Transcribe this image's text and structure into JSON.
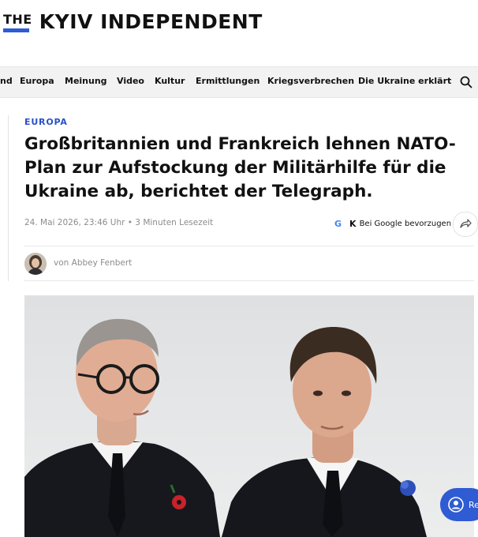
{
  "brand": {
    "the": "THE",
    "name": "KYIV INDEPENDENT",
    "accent": "#2f5bd3"
  },
  "nav": {
    "items": [
      "nd",
      "Europa",
      "Meinung",
      "Video",
      "Kultur",
      "Ermittlungen",
      "Kriegsverbrechen",
      "Die Ukraine erklärt"
    ],
    "search_icon": "search-icon"
  },
  "article": {
    "category": "EUROPA",
    "headline": "Großbritannien und Frankreich lehnen NATO-Plan zur Aufstockung der Militärhilfe für die Ukraine ab, berichtet der Telegraph.",
    "meta": "24. Mai 2026, 23:46 Uhr • 3 Minuten Lesezeit",
    "google_icon": "G",
    "kyiv_icon": "K",
    "google_label": "Bei Google bevorzugen",
    "share_icon": "share-arrow-icon",
    "byline": "von Abbey Fenbert"
  },
  "floating_button": {
    "label": "Re",
    "icon": "user-circle-icon"
  }
}
